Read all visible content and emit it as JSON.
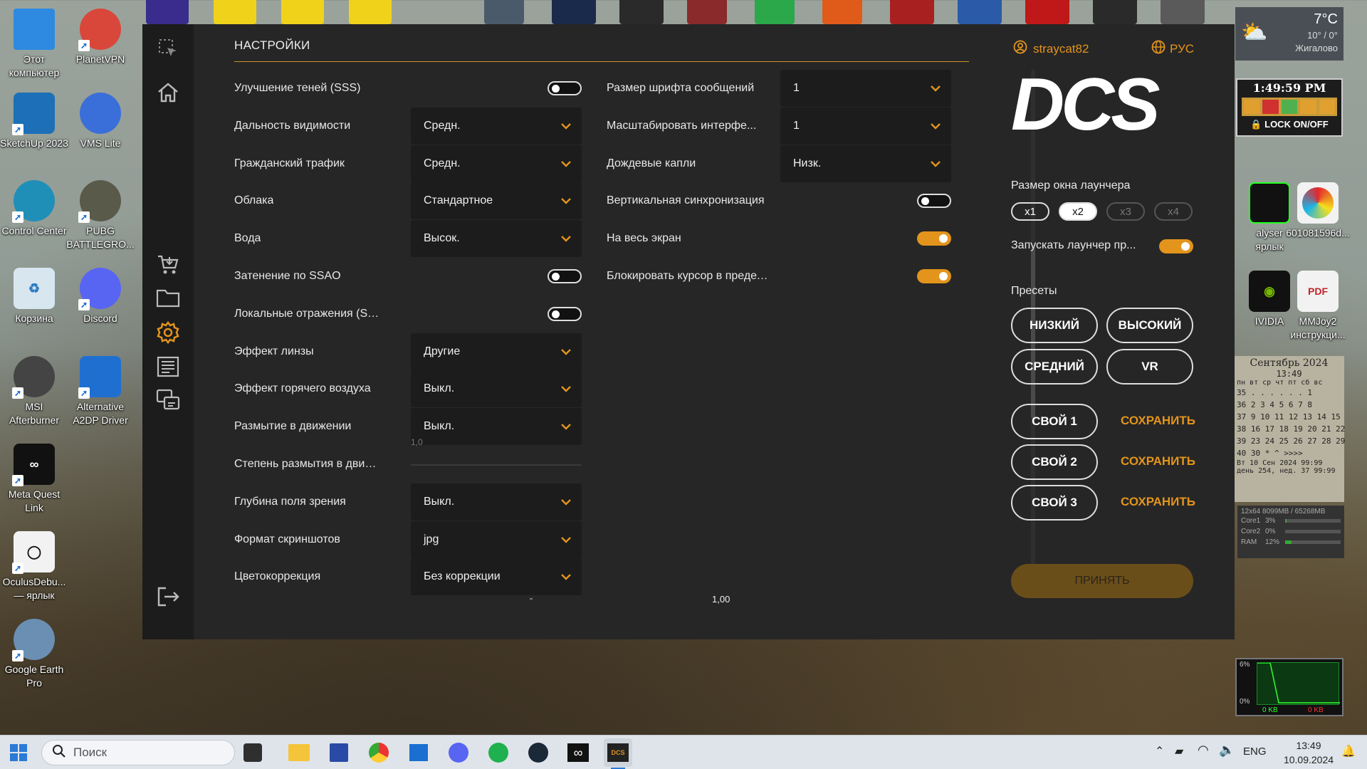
{
  "desktop": {
    "left_icons": [
      {
        "label": "Этот компьютер",
        "color": "#2d8ae0"
      },
      {
        "label": "SketchUp 2023",
        "color": "#1d6fb8"
      },
      {
        "label": "Control Center",
        "color": "#1f8fb8"
      },
      {
        "label": "Корзина",
        "color": "#8fb9d9"
      },
      {
        "label": "MSI Afterburner",
        "color": "#444"
      },
      {
        "label": "Meta Quest Link",
        "color": "#111"
      },
      {
        "label": "OculusDebu... — ярлык",
        "color": "#f2f2f2"
      },
      {
        "label": "Google Earth Pro",
        "color": "#6a8fb3"
      }
    ],
    "second_icons": [
      {
        "label": "PlanetVPN",
        "color": "#d9473a"
      },
      {
        "label": "VMS Lite",
        "color": "#3a6fd9"
      },
      {
        "label": "PUBG BATTLEGRO...",
        "color": "#5a5a4a"
      },
      {
        "label": "Discord",
        "color": "#5865f2"
      },
      {
        "label": "Alternative A2DP Driver",
        "color": "#1f6fd0"
      }
    ],
    "right_icons": [
      {
        "label": "601081596d...",
        "color": "#f2f2f2"
      },
      {
        "label": "MMJoy2 инструкци...",
        "color": "#f2f2f2"
      }
    ],
    "partial_labels": {
      "analyser": "alyser",
      "shortcut": "ярлык",
      "nvidia": "IVIDIA"
    }
  },
  "weather": {
    "temp": "7°C",
    "range": "10° / 0°",
    "city": "Жигалово"
  },
  "clock_widget": {
    "time": "1:49:59 PM",
    "lock_label": "LOCK ON/OFF"
  },
  "calendar": {
    "month": "Сентябрь 2024",
    "time": "13:49",
    "days_header": "пн вт ср чт пт сб вс",
    "weeks": [
      "35 . . . . . . 1",
      "36 2 3 4 5 6 7 8",
      "37 9 10 11 12 13 14 15",
      "38 16 17 18 19 20 21 22",
      "39 23 24 25 26 27 28 29",
      "40 30 * ^ >>>>"
    ],
    "footer1": "Вт 10 Сен 2024  99:99",
    "footer2": "день 254, нед. 37 99:99"
  },
  "sysmon": {
    "header": "12x64  8099MB / 65268MB",
    "rows": [
      {
        "name": "Core1",
        "val": "3%"
      },
      {
        "name": "Core2",
        "val": "0%"
      },
      {
        "name": "RAM",
        "val": "12%"
      }
    ]
  },
  "netmon": {
    "top": "6%",
    "bottom": "0%",
    "left_kb": "0 KB",
    "right_kb": "0 KB"
  },
  "launcher": {
    "title": "НАСТРОЙКИ",
    "user": "straycat82",
    "language": "РУС",
    "logo": "DCS",
    "left_settings": [
      {
        "label": "Улучшение теней (SSS)",
        "type": "toggle",
        "on": false
      },
      {
        "label": "Дальность видимости",
        "type": "select",
        "value": "Средн."
      },
      {
        "label": "Гражданский трафик",
        "type": "select",
        "value": "Средн."
      },
      {
        "label": "Облака",
        "type": "select",
        "value": "Стандартное"
      },
      {
        "label": "Вода",
        "type": "select",
        "value": "Высок."
      },
      {
        "label": "Затенение по SSAO",
        "type": "toggle",
        "on": false
      },
      {
        "label": "Локальные отражения (SSLR)",
        "type": "toggle",
        "on": false
      },
      {
        "label": "Эффект линзы",
        "type": "select",
        "value": "Другие"
      },
      {
        "label": "Эффект горячего воздуха",
        "type": "select",
        "value": "Выкл."
      },
      {
        "label": "Размытие в движении",
        "type": "select",
        "value": "Выкл."
      },
      {
        "label": "Степень размытия в движ...",
        "type": "slider",
        "value": "1,0"
      },
      {
        "label": "Глубина поля зрения",
        "type": "select",
        "value": "Выкл."
      },
      {
        "label": "Формат скриншотов",
        "type": "select",
        "value": "jpg"
      },
      {
        "label": "Цветокоррекция",
        "type": "select",
        "value": "Без коррекции"
      }
    ],
    "bottom_value": "1,00",
    "mid_settings": [
      {
        "label": "Размер шрифта сообщений",
        "type": "select",
        "value": "1"
      },
      {
        "label": "Масштабировать интерфе...",
        "type": "select",
        "value": "1"
      },
      {
        "label": "Дождевые капли",
        "type": "select",
        "value": "Низк."
      },
      {
        "label": "Вертикальная синхронизация",
        "type": "toggle",
        "on": false
      },
      {
        "label": "На весь экран",
        "type": "toggle",
        "on": true
      },
      {
        "label": "Блокировать курсор в пределах игрового окна",
        "type": "toggle",
        "on": true
      }
    ],
    "window_size_label": "Размер окна лаунчера",
    "sizes": [
      "x1",
      "x2",
      "x3",
      "x4"
    ],
    "selected_size": "x2",
    "autostart_label": "Запускать лаунчер пр...",
    "autostart_on": true,
    "presets_label": "Пресеты",
    "presets": [
      "НИЗКИЙ",
      "ВЫСОКИЙ",
      "СРЕДНИЙ",
      "VR"
    ],
    "custom": [
      "СВОЙ 1",
      "СВОЙ 2",
      "СВОЙ 3"
    ],
    "save_label": "СОХРАНИТЬ",
    "apply_label": "ПРИНЯТЬ"
  },
  "taskbar": {
    "search_placeholder": "Поиск",
    "lang": "ENG",
    "time": "13:49",
    "date": "10.09.2024"
  },
  "colors": {
    "accent": "#e3941c",
    "panel": "#262626"
  }
}
